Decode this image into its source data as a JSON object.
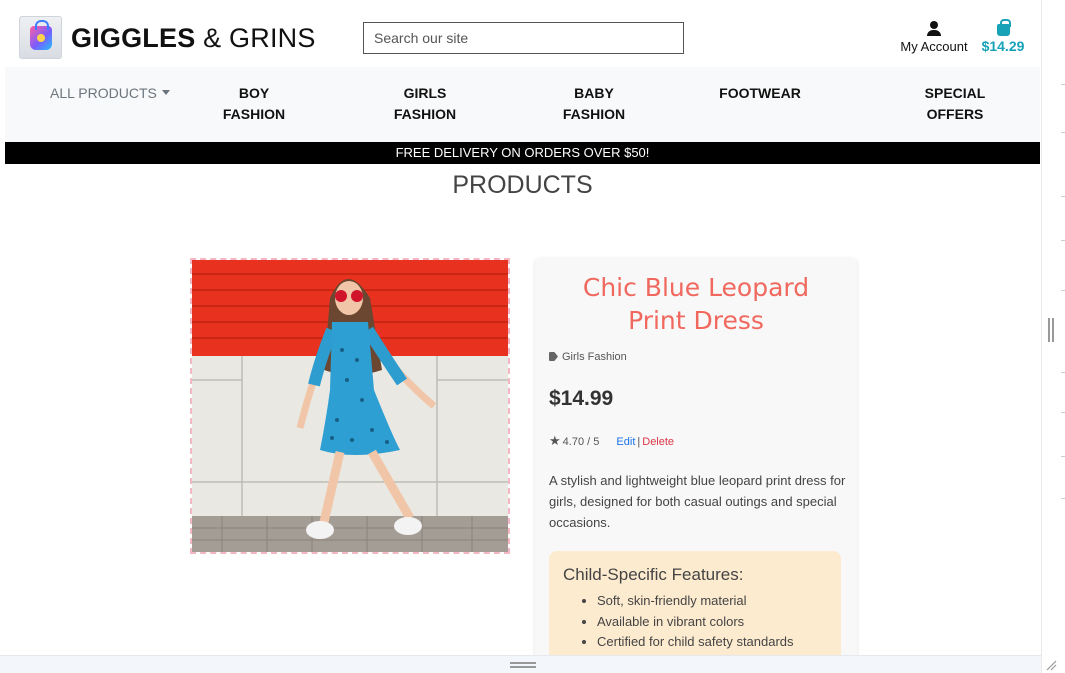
{
  "header": {
    "brand_bold": "GIGGLES",
    "brand_amp": " & ",
    "brand_rest": "GRINS",
    "search_placeholder": "Search our site",
    "account_label": "My Account",
    "cart_total": "$14.29"
  },
  "nav": {
    "all_products": "ALL PRODUCTS",
    "items": [
      {
        "line1": "BOY",
        "line2": "FASHION"
      },
      {
        "line1": "GIRLS",
        "line2": "FASHION"
      },
      {
        "line1": "BABY",
        "line2": "FASHION"
      },
      {
        "line1": "FOOTWEAR",
        "line2": ""
      },
      {
        "line1": "SPECIAL",
        "line2": "OFFERS"
      }
    ]
  },
  "banner": "FREE DELIVERY ON ORDERS OVER $50!",
  "page_title": "PRODUCTS",
  "product": {
    "title_line1": "Chic Blue Leopard",
    "title_line2": "Print Dress",
    "category": "Girls Fashion",
    "price": "$14.99",
    "rating": "4.70 / 5",
    "edit_label": "Edit",
    "separator": "|",
    "delete_label": "Delete",
    "description": "A stylish and lightweight blue leopard print dress for girls, designed for both casual outings and special occasions.",
    "features_title": "Child-Specific Features:",
    "features": [
      "Soft, skin-friendly material",
      "Available in vibrant colors",
      "Certified for child safety standards"
    ]
  },
  "colors": {
    "accent_teal": "#17a2b8",
    "title_coral": "#f0685e",
    "features_bg": "#fdebd0",
    "delete_red": "#dc3545",
    "edit_blue": "#1a73e8"
  },
  "icons": [
    "brand-logo-icon",
    "person-icon",
    "shopping-bag-icon",
    "caret-down-icon",
    "tag-icon",
    "star-icon"
  ]
}
